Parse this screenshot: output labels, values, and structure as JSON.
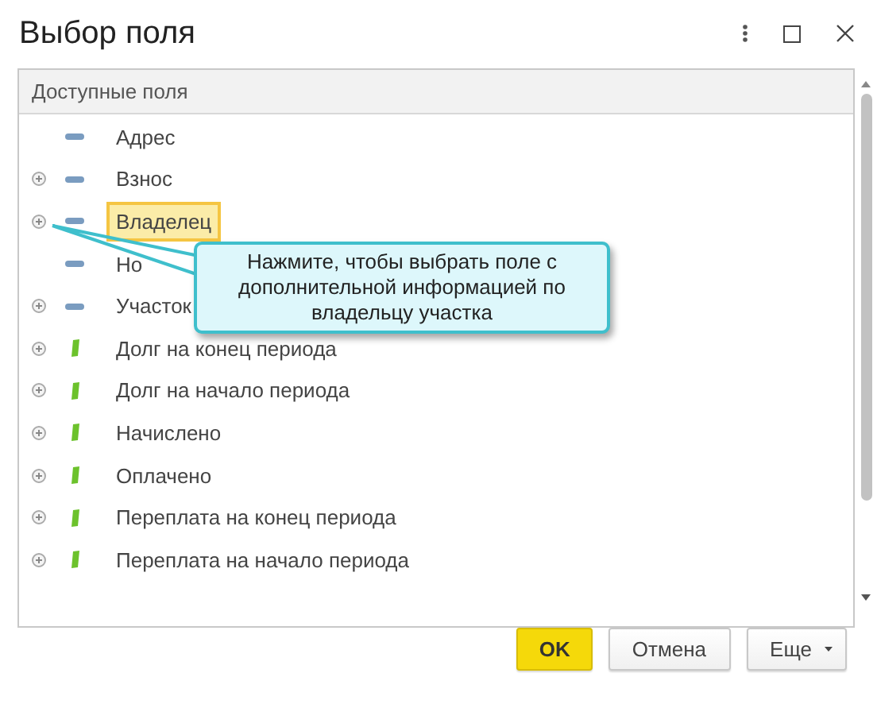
{
  "window": {
    "title": "Выбор поля"
  },
  "list": {
    "header": "Доступные поля",
    "items": [
      {
        "label": "Адрес",
        "kind": "attribute",
        "expandable": false,
        "selected": false
      },
      {
        "label": "Взнос",
        "kind": "attribute",
        "expandable": true,
        "selected": false
      },
      {
        "label": "Владелец",
        "kind": "attribute",
        "expandable": true,
        "selected": true
      },
      {
        "label": "Но",
        "kind": "attribute",
        "expandable": false,
        "selected": false
      },
      {
        "label": "Участок",
        "kind": "attribute",
        "expandable": true,
        "selected": false
      },
      {
        "label": "Долг на конец периода",
        "kind": "resource",
        "expandable": true,
        "selected": false
      },
      {
        "label": "Долг на начало периода",
        "kind": "resource",
        "expandable": true,
        "selected": false
      },
      {
        "label": "Начислено",
        "kind": "resource",
        "expandable": true,
        "selected": false
      },
      {
        "label": "Оплачено",
        "kind": "resource",
        "expandable": true,
        "selected": false
      },
      {
        "label": "Переплата на конец периода",
        "kind": "resource",
        "expandable": true,
        "selected": false
      },
      {
        "label": "Переплата на начало периода",
        "kind": "resource",
        "expandable": true,
        "selected": false
      }
    ]
  },
  "callout": {
    "text": "Нажмите, чтобы выбрать поле с дополнительной информацией по владельцу участка"
  },
  "buttons": [
    {
      "label": "OK",
      "kind": "primary"
    },
    {
      "label": "Отмена",
      "kind": "plain"
    },
    {
      "label": "Еще",
      "kind": "menu"
    }
  ]
}
